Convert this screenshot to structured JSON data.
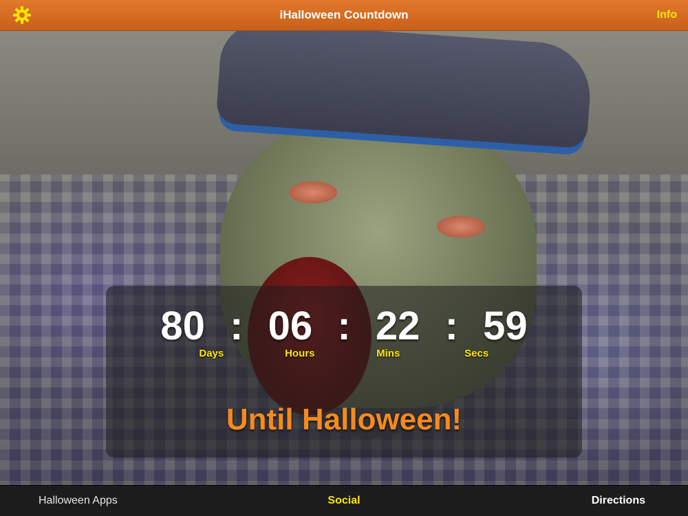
{
  "header": {
    "title": "iHalloween Countdown",
    "info_label": "Info",
    "settings_icon": "gear-icon",
    "accent_color": "#d96c20",
    "icon_color": "#ffe600"
  },
  "countdown": {
    "days": "80",
    "hours": "06",
    "mins": "22",
    "secs": "59",
    "separator": ":",
    "labels": {
      "days": "Days",
      "hours": "Hours",
      "mins": "Mins",
      "secs": "Secs"
    },
    "caption": "Until Halloween!"
  },
  "tabbar": {
    "items": [
      {
        "label": "Halloween Apps",
        "selected": false
      },
      {
        "label": "Social",
        "selected": true
      },
      {
        "label": "Directions",
        "selected": false
      }
    ]
  }
}
